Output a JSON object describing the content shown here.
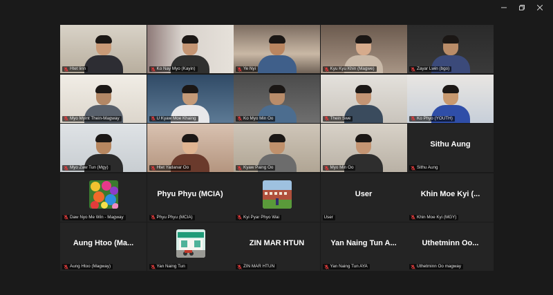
{
  "window": {
    "controls": [
      {
        "name": "minimize-icon",
        "glyph": "—"
      },
      {
        "name": "restore-icon",
        "glyph": "❐"
      },
      {
        "name": "close-icon",
        "glyph": "✕"
      }
    ]
  },
  "colors": {
    "background": "#1a1a1a",
    "tile": "#242424",
    "muted_mic": "#e23b3b",
    "name_text": "#e8e8e8"
  },
  "participants": [
    {
      "name": "Htet linn",
      "video": true,
      "muted": true
    },
    {
      "name": "Ko Nay Myo (Kayin)",
      "video": true,
      "muted": true
    },
    {
      "name": "Ye Nyi",
      "video": true,
      "muted": true
    },
    {
      "name": "Kyu Kyu Khin (Magwe)",
      "video": true,
      "muted": true
    },
    {
      "name": "Zayar Lwin (bgo)",
      "video": true,
      "muted": true
    },
    {
      "name": "Myo Myint Thein-Magway",
      "video": true,
      "muted": true
    },
    {
      "name": "U Kyaw Moe Khaing",
      "video": true,
      "muted": true
    },
    {
      "name": "Ko Myo Min Oo",
      "video": true,
      "muted": true
    },
    {
      "name": "Thein Swe",
      "video": true,
      "muted": true
    },
    {
      "name": "Ko Phyo (YOUTH)",
      "video": true,
      "muted": true
    },
    {
      "name": "Myo Zaw Tun (Mgy)",
      "video": true,
      "muted": true
    },
    {
      "name": "Htet Yadanar Oo",
      "video": true,
      "muted": true
    },
    {
      "name": "Kyaw Paing Oo",
      "video": true,
      "muted": true
    },
    {
      "name": "Myo Min Oo",
      "video": true,
      "muted": true
    },
    {
      "name": "Sithu Aung",
      "display": "Sithu Aung",
      "video": false,
      "muted": true
    },
    {
      "name": "Daw Nyo Me Win - Magway",
      "video": false,
      "avatar": "flowers",
      "muted": true
    },
    {
      "name": "Phyu Phyu (MCIA)",
      "display": "Phyu Phyu (MCIA)",
      "video": false,
      "muted": true
    },
    {
      "name": "Kyi Pyar Phyo Wai",
      "video": false,
      "avatar": "building",
      "muted": true
    },
    {
      "name": "User",
      "display": "User",
      "video": false,
      "muted": false
    },
    {
      "name": "Khin Moe Kyi (MGY)",
      "display": "Khin Moe Kyi (...",
      "video": false,
      "muted": true
    },
    {
      "name": "Aung Htoo (Magway)",
      "display": "Aung Htoo (Ma...",
      "video": false,
      "muted": true
    },
    {
      "name": "Yan Naing Tun",
      "video": false,
      "avatar": "shop",
      "muted": true
    },
    {
      "name": "ZIN MAR HTUN",
      "display": "ZIN MAR HTUN",
      "video": false,
      "muted": true
    },
    {
      "name": "Yan Naing Tun AYA",
      "display": "Yan Naing Tun A...",
      "video": false,
      "muted": true
    },
    {
      "name": "Uthetminn Oo magway",
      "display": "Uthetminn Oo...",
      "video": false,
      "muted": true
    }
  ]
}
